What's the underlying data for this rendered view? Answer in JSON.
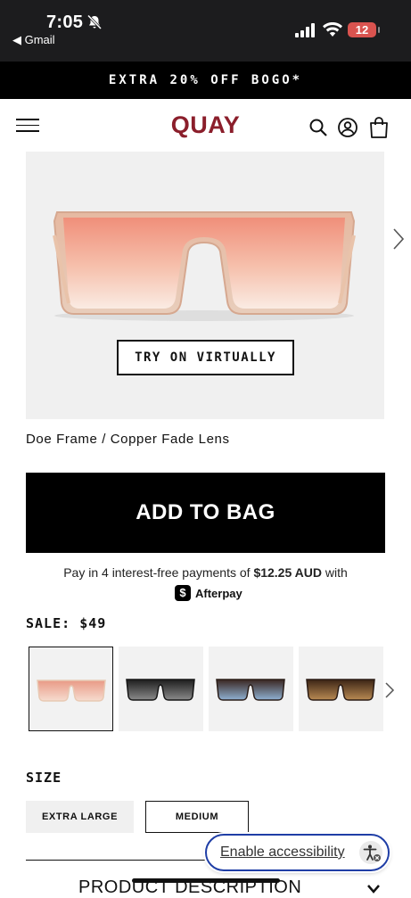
{
  "status_bar": {
    "time": "7:05",
    "back_app": "◀ Gmail",
    "battery": "12"
  },
  "promo_banner": {
    "text": "EXTRA 20% OFF BOGO*"
  },
  "header": {
    "logo": "QUAY",
    "icons": [
      "menu-icon",
      "search-icon",
      "account-icon",
      "bag-icon"
    ]
  },
  "product": {
    "try_on_label": "TRY ON VIRTUALLY",
    "title": "Doe Frame / Copper Fade Lens",
    "add_to_bag_label": "ADD TO BAG",
    "afterpay": {
      "prefix": "Pay in 4 interest-free payments of",
      "amount": "$12.25 AUD",
      "suffix": "with",
      "brand": "Afterpay"
    },
    "sale_label": "SALE:",
    "sale_price": "$49",
    "swatches": [
      {
        "lens": "copper-fade",
        "frame": "#e8c9b3",
        "lens_top": "#e99a86",
        "lens_bottom": "#f6dccf",
        "selected": true
      },
      {
        "lens": "black-fade",
        "frame": "#151515",
        "lens_top": "#1d1d1d",
        "lens_bottom": "#8a8a8a",
        "selected": false
      },
      {
        "lens": "brown-blue",
        "frame": "#2a1d18",
        "lens_top": "#3a2620",
        "lens_bottom": "#8fb1d3",
        "selected": false
      },
      {
        "lens": "brown-fade",
        "frame": "#2a1b14",
        "lens_top": "#3b2415",
        "lens_bottom": "#b98a53",
        "selected": false
      }
    ]
  },
  "size": {
    "label": "SIZE",
    "options": [
      "EXTRA LARGE",
      "MEDIUM"
    ],
    "selected": "MEDIUM"
  },
  "accessibility": {
    "label": "Enable accessibility"
  },
  "product_description": {
    "label": "PRODUCT DESCRIPTION"
  }
}
